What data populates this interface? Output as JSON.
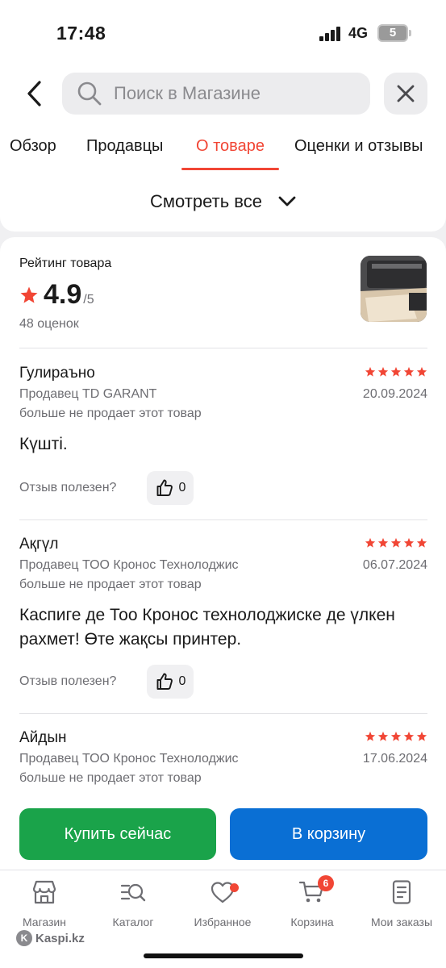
{
  "status_bar": {
    "time": "17:48",
    "network": "4G",
    "battery": "5"
  },
  "search": {
    "placeholder": "Поиск в Магазине"
  },
  "tabs": [
    {
      "label": "Обзор"
    },
    {
      "label": "Продавцы"
    },
    {
      "label": "О товаре",
      "active": true
    },
    {
      "label": "Оценки и отзывы"
    }
  ],
  "see_all": {
    "label": "Смотреть все"
  },
  "rating": {
    "title": "Рейтинг товара",
    "value": "4.9",
    "max": "/5",
    "count": "48 оценок",
    "stars": 4.9
  },
  "reviews": [
    {
      "name": "Гулираъно",
      "stars": 5,
      "seller": "Продавец TD GARANT",
      "date": "20.09.2024",
      "note": "больше не продает этот товар",
      "text": "Күшті.",
      "helpful_label": "Отзыв полезен?",
      "likes": "0"
    },
    {
      "name": "Ақгүл",
      "stars": 5,
      "seller": "Продавец ТОО Кронос Технолоджис",
      "date": "06.07.2024",
      "note": "больше не продает этот товар",
      "text": "Каспиге де Тоо Кронос технолоджиске де үлкен рахмет! Өте жақсы принтер.",
      "helpful_label": "Отзыв полезен?",
      "likes": "0"
    },
    {
      "name": "Айдын",
      "stars": 5,
      "seller": "Продавец ТОО Кронос Технолоджис",
      "date": "17.06.2024",
      "note": "больше не продает этот товар"
    }
  ],
  "actions": {
    "buy_now": "Купить сейчас",
    "to_cart": "В корзину"
  },
  "nav": [
    {
      "label": "Магазин",
      "icon": "shop-icon"
    },
    {
      "label": "Каталог",
      "icon": "catalog-search-icon"
    },
    {
      "label": "Избранное",
      "icon": "heart-icon"
    },
    {
      "label": "Корзина",
      "icon": "cart-icon",
      "badge": "6"
    },
    {
      "label": "Мои заказы",
      "icon": "orders-icon"
    }
  ],
  "watermark": "Kaspi.kz",
  "colors": {
    "accent": "#f14635",
    "buy": "#1aa34a",
    "cart": "#0a6fd4"
  }
}
